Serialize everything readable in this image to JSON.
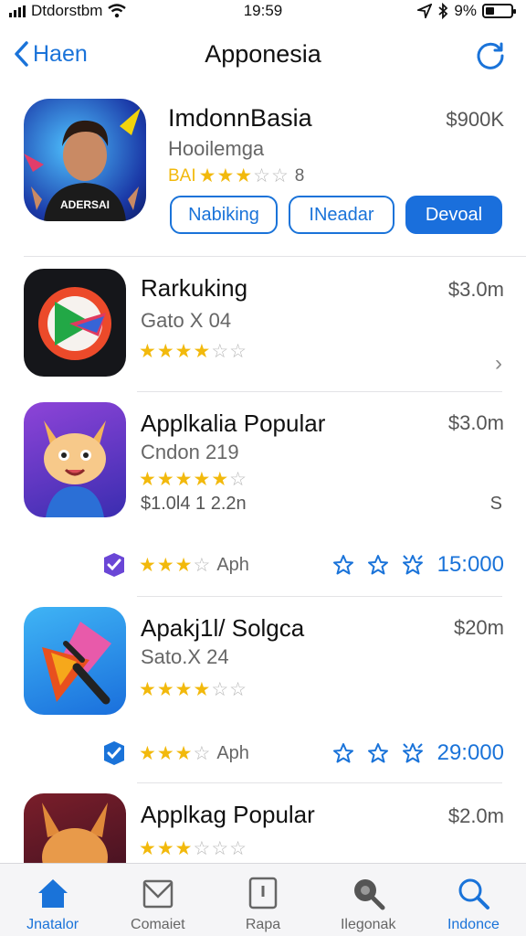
{
  "status": {
    "carrier": "Dtdorstbm",
    "time": "19:59",
    "battery": "9%"
  },
  "nav": {
    "back_label": "Haen",
    "title": "Apponesia"
  },
  "featured": {
    "name": "ImdonnBasia",
    "subtitle": "Hooilemga",
    "stars_prefix": "BAI",
    "rating": 3.5,
    "rating_count": "8",
    "price": "$900K",
    "buttons": [
      "Nabiking",
      "INeadar",
      "Devoal"
    ],
    "icon_text": "ADERSAI"
  },
  "apps": [
    {
      "name": "Rarkuking",
      "subtitle": "Gato X 04",
      "price": "$3.0m",
      "rating": 3.5,
      "chevron": "›"
    },
    {
      "name": "Applkalia Popular",
      "subtitle": "Cndon 219",
      "price": "$3.0m",
      "rating": 4.5,
      "extra": "$1.0l4 1 2.2n",
      "extra_right": "S",
      "footer": {
        "rating": 2.5,
        "label": "Aph",
        "count": "15:000"
      }
    },
    {
      "name": "Apakj1l/ Solgca",
      "subtitle": "Sato.X 24",
      "price": "$20m",
      "rating": 3.5,
      "footer": {
        "rating": 2.5,
        "label": "Aph",
        "count": "29:000"
      }
    },
    {
      "name": "Applkag Popular",
      "price": "$2.0m",
      "rating": 2.5
    }
  ],
  "tabs": [
    {
      "label": "Jnatalor",
      "icon": "home-icon",
      "active": true
    },
    {
      "label": "Comaiet",
      "icon": "mail-icon",
      "active": false
    },
    {
      "label": "Rapa",
      "icon": "tablet-icon",
      "active": false
    },
    {
      "label": "Ilegonak",
      "icon": "search-icon",
      "active": false
    },
    {
      "label": "Indonce",
      "icon": "search-icon",
      "active": true
    }
  ],
  "colors": {
    "accent": "#1a73d9",
    "star": "#f2b90c"
  }
}
